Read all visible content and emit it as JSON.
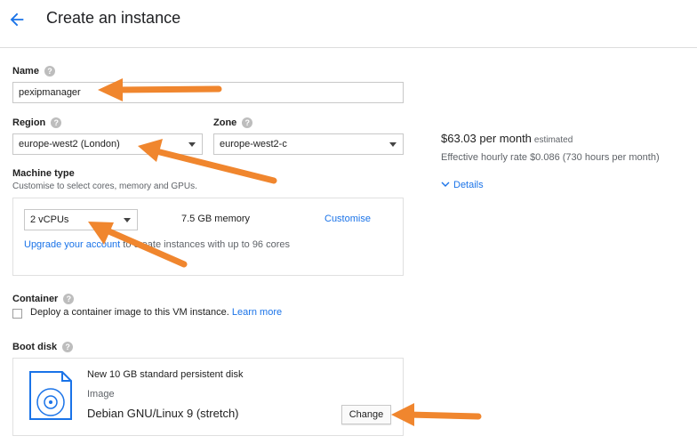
{
  "header": {
    "title": "Create an instance"
  },
  "name": {
    "label": "Name",
    "value": "pexipmanager"
  },
  "region": {
    "label": "Region",
    "value": "europe-west2 (London)"
  },
  "zone": {
    "label": "Zone",
    "value": "europe-west2-c"
  },
  "machine": {
    "label": "Machine type",
    "description": "Customise to select cores, memory and GPUs.",
    "cpus": "2 vCPUs",
    "memory": "7.5 GB memory",
    "customise": "Customise",
    "upgrade_link": "Upgrade your account",
    "upgrade_text": " to create instances with up to 96 cores"
  },
  "cost": {
    "amount": "$63.03 per month",
    "estimated": "estimated",
    "hourly": "Effective hourly rate $0.086 (730 hours per month)",
    "details": "Details"
  },
  "container": {
    "label": "Container",
    "checkbox_text": "Deploy a container image to this VM instance.",
    "learn_more": "Learn more",
    "checked": false
  },
  "boot_disk": {
    "label": "Boot disk",
    "title": "New 10 GB standard persistent disk",
    "image_label": "Image",
    "image": "Debian GNU/Linux 9 (stretch)",
    "change": "Change"
  },
  "colors": {
    "accent": "#1a73e8",
    "annotation_arrow": "#f0862e"
  },
  "icons": {
    "back": "arrow-left-icon",
    "help": "help-icon",
    "details": "chevron-down-icon",
    "disk": "disk-icon"
  }
}
